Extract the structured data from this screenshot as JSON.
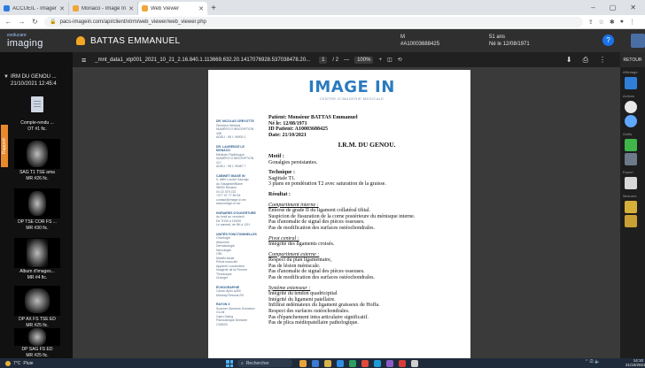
{
  "browser": {
    "tabs": [
      {
        "label": "ACCUEIL - Imagerie Monaco",
        "color": "#2d7be0",
        "active": false
      },
      {
        "label": "Monaco - Image In",
        "color": "#f0a63b",
        "active": false
      },
      {
        "label": "Web Viewer",
        "color": "#f0a63b",
        "active": true
      }
    ],
    "new_tab": "+",
    "url": "pacs-imagein.com/api/client/xtrm/web_viewer/web_viewer.php",
    "window_controls": [
      "–",
      "▢",
      "✕"
    ]
  },
  "app": {
    "logo_small": "evolucare",
    "logo_big": "imaging",
    "logo_badge": "1 / 1",
    "patient_name": "BATTAS EMMANUEL",
    "sex_label": "M",
    "patient_id": "#A10003688425",
    "age": "51 ans",
    "birth": "Né le 12/08/1971",
    "help": "?"
  },
  "viewer": {
    "menu": "≡",
    "filename": "_mnt_data1_xtp001_2021_10_21_2.16.840.1.113669.632.20.1417076928.537038478.20...",
    "page_current": "1",
    "page_total": "/ 2",
    "zoom": "100%",
    "zoom_minus": "—",
    "zoom_plus": "+",
    "download": "⬇",
    "print": "⎙",
    "more": "⋮"
  },
  "left_panel": {
    "rapport_label": "Rapport",
    "study_title": "IRM DU GENOU ...",
    "study_date": "21/10/2021 12:45:4",
    "thumbnails": [
      {
        "label": "Compte-rendu ...",
        "sub": "OT #1 fic."
      },
      {
        "label": "SAG T1 TSE ama",
        "sub": "MR #26 fic."
      },
      {
        "label": "DP TSE COR FS ...",
        "sub": "MR #30 fic."
      },
      {
        "label": "Album d'images...",
        "sub": "MR #4 fic."
      },
      {
        "label": "DP AX FS TSE ED",
        "sub": "MR #25 fic."
      },
      {
        "label": "DP SAG FS ED",
        "sub": "MR #25 fic."
      }
    ]
  },
  "report": {
    "brand": "IMAGE IN",
    "brand_sub": "CENTRE D'IMAGERIE MEDICALE",
    "patient_line": "Patient: Monsieur BATTAS Emmanuel",
    "born_line": "Né le: 12/08/1971",
    "id_line": "ID Patient: A10003688425",
    "date_line": "Date: 21/10/2021",
    "exam_title": "I.R.M. DU GENOU.",
    "motif_label": "Motif :",
    "motif_text": "Gonalgies persistantes.",
    "tech_label": "Technique :",
    "tech_line1": "Sagittale T1.",
    "tech_line2": "3 plans en pondération T2 avec saturation de la graisse.",
    "result_label": "Résultat :",
    "internal_label": "Compartiment interne :",
    "internal_lines": [
      "Entorse de grade II du ligament collatéral tibial.",
      "Suspicion de fissuration de la corne postérieure du ménisque interne.",
      "Pas d'anomalie de signal des pièces osseuses.",
      "Pas de modification des surfaces ostéochondrales."
    ],
    "pivot_label": "Pivot central :",
    "pivot_lines": [
      "Intégrité des ligaments croisés."
    ],
    "external_label": "Compartiment externe :",
    "external_lines": [
      "Respect du plan ligamentaire,",
      "Pas de lésion méniscale.",
      "Pas d'anomalie de signal des pièces osseuses.",
      "Pas de modification des surfaces ostéochondrales."
    ],
    "extensor_label": "Système extenseur :",
    "extensor_lines": [
      "Intégrité du tendon quadricipital",
      "Intégrité du ligament patellaire.",
      "Infiltrat œdémateux du ligament graisseux de Hoffa.",
      "Respect des surfaces ostéochondrales.",
      "Pas d'épanchement intra articulaire significatif.",
      "Pas de plica médiopatellaire pathologique."
    ],
    "sidebar": [
      {
        "head": "DR. NICOLAS CREVOTTE",
        "lines": [
          "Directeur Médical",
          "NUMÉRO D'INSCRIPTION",
          "408",
          "ADELI : 98 1 99000 1"
        ]
      },
      {
        "head": "DR. LAURENCE LE MONACO",
        "lines": [
          "Médecin Radiologue",
          "NUMÉRO D'INSCRIPTION",
          "417",
          "ADELI : 98 1 99487 7"
        ]
      },
      {
        "head": "CABINET IMAGE IN",
        "lines": [
          "9, allée Louise Gauvigo",
          "Au Saugeaie/Blane",
          "98000 Monaco",
          "04 22 379 222",
          "+377 97 77 89 63",
          "contact@image-in.mc",
          "www.image-in.mc"
        ]
      },
      {
        "head": "HORAIRES D'OUVERTURE",
        "lines": [
          "du lundi au vendredi",
          "De 7H30 à 19H30",
          "Le samedi, de 8H à 12H"
        ]
      },
      {
        "head": "UNITÉS FONCTIONNELLES",
        "lines": [
          "Oncologie",
          "Abdomen",
          "Dermatologie",
          "Neurologie",
          "ORL",
          "Maxillo-facial",
          "Pelvis masculin",
          "Appareil Locomoteur",
          "Imagerie de la Femme",
          "Thoracique",
          "Urologie"
        ]
      },
      {
        "head": "ÉCHOGRAPHIE",
        "lines": [
          "Canon Aplio a450",
          "Mindray Resona R9"
        ]
      },
      {
        "head": "RAYON X",
        "lines": [
          "Scanner Siemens Somatom Go All",
          "Open Swing",
          "Panoramique Dentaire CS8000"
        ]
      }
    ]
  },
  "right_panel": {
    "back": "RETOUR",
    "sections": [
      "Affichage",
      "Actions",
      "Outils",
      "Export",
      "Mesures"
    ]
  },
  "taskbar": {
    "weather_temp": "7°C",
    "weather_text": "Pluie",
    "search_placeholder": "Rechercher",
    "tray_lang": "⌃ ⎚ 🔈",
    "time": "14:10",
    "date": "21/10/2021"
  },
  "colors": {
    "accent": "#e8892b",
    "brand_blue": "#2b7bbf",
    "header_bg": "#2f2f2f"
  }
}
